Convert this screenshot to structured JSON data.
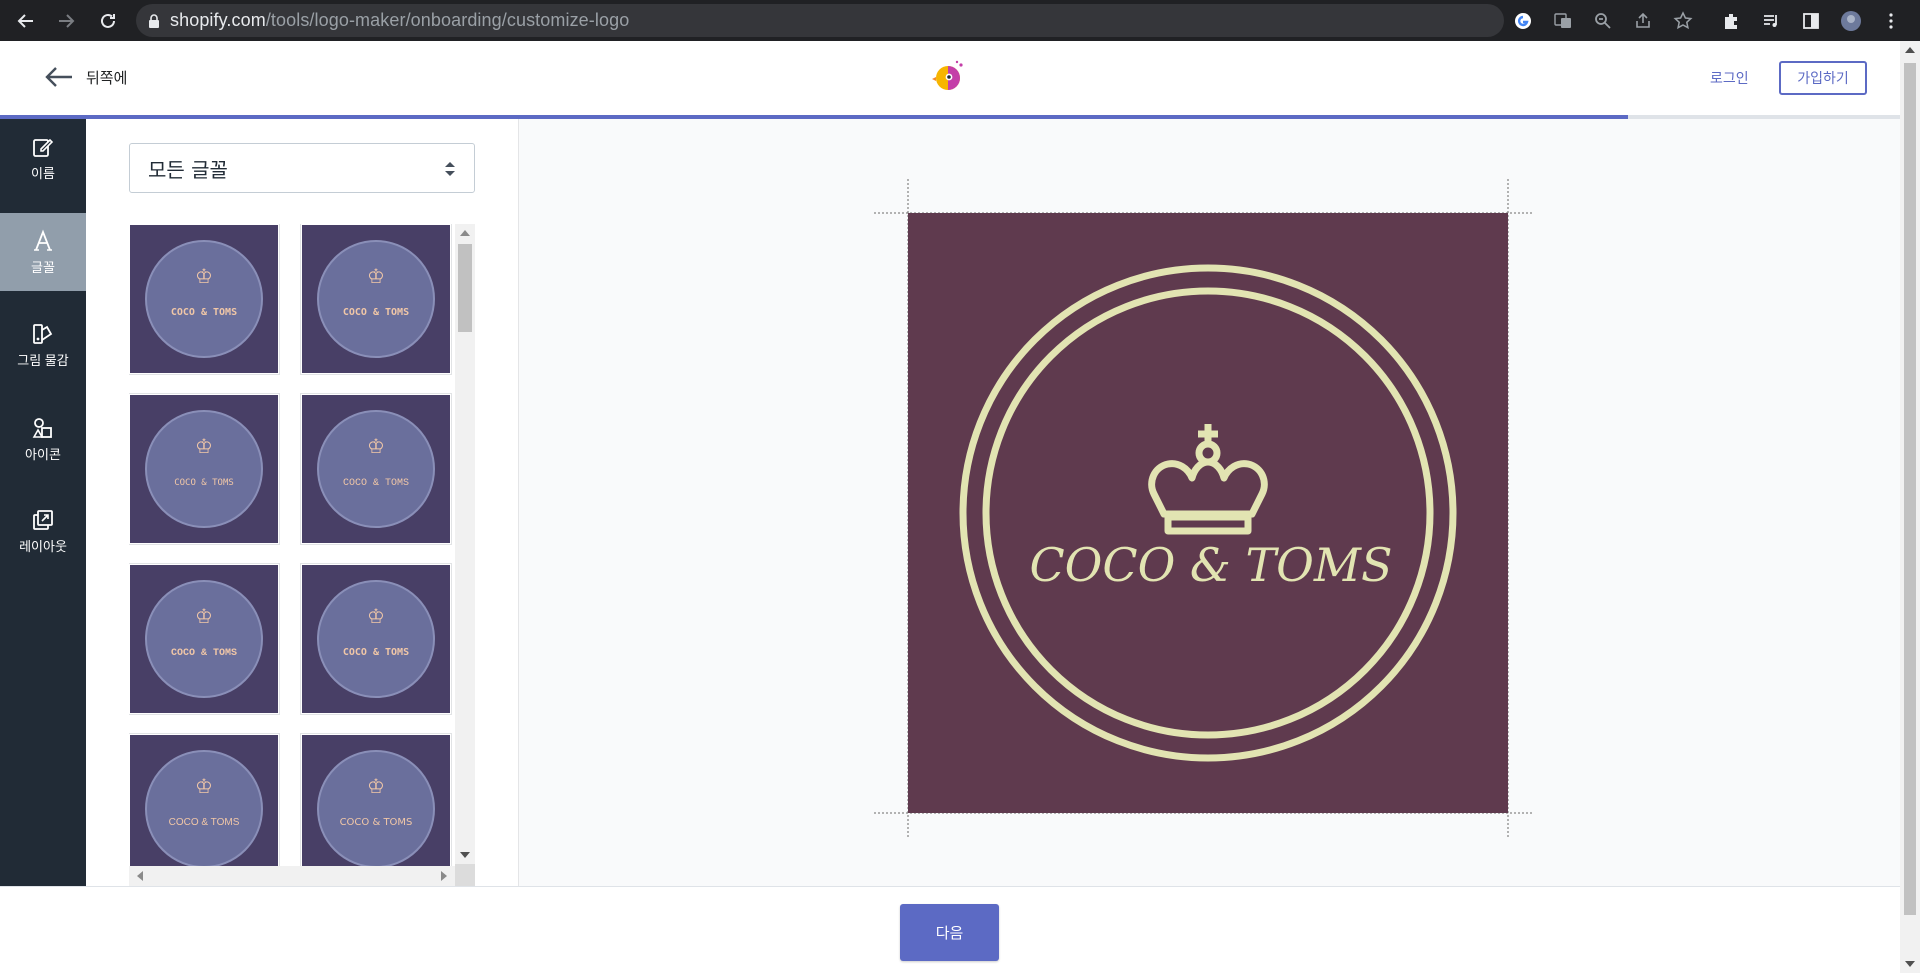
{
  "browser": {
    "url_host": "shopify.com",
    "url_path": "/tools/logo-maker/onboarding/customize-logo"
  },
  "header": {
    "back_label": "뒤쪽에",
    "login_label": "로그인",
    "signup_label": "가입하기",
    "progress_fraction": 0.857
  },
  "sidebar": {
    "items": [
      {
        "label": "이름",
        "icon": "edit-icon",
        "active": false
      },
      {
        "label": "글꼴",
        "icon": "font-icon",
        "active": true
      },
      {
        "label": "그림 물감",
        "icon": "paint-icon",
        "active": false
      },
      {
        "label": "아이콘",
        "icon": "shapes-icon",
        "active": false
      },
      {
        "label": "레이아웃",
        "icon": "layout-icon",
        "active": false
      }
    ]
  },
  "font_panel": {
    "select_value": "모든 글꼴",
    "tiles": [
      {
        "text": "COCO & TOMS"
      },
      {
        "text": "COCO & TOMS"
      },
      {
        "text": "COCO & TOMS"
      },
      {
        "text": "COCO & TOMS"
      },
      {
        "text": "COCO & TOMS"
      },
      {
        "text": "COCO & TOMS"
      },
      {
        "text": "COCO & TOMS"
      },
      {
        "text": "COCO & TOMS"
      }
    ]
  },
  "preview": {
    "brand_text": "COCO & TOMS",
    "background_color": "#5f3a4e",
    "foreground_color": "#e2e4b2",
    "icon": "crown-icon"
  },
  "footer": {
    "next_label": "다음"
  },
  "colors": {
    "accent": "#5c6ac4",
    "tile_background": "#483f66",
    "tile_circle": "#6a6f9c",
    "tile_text": "#f1c7a7",
    "rail_background": "#212b36"
  }
}
